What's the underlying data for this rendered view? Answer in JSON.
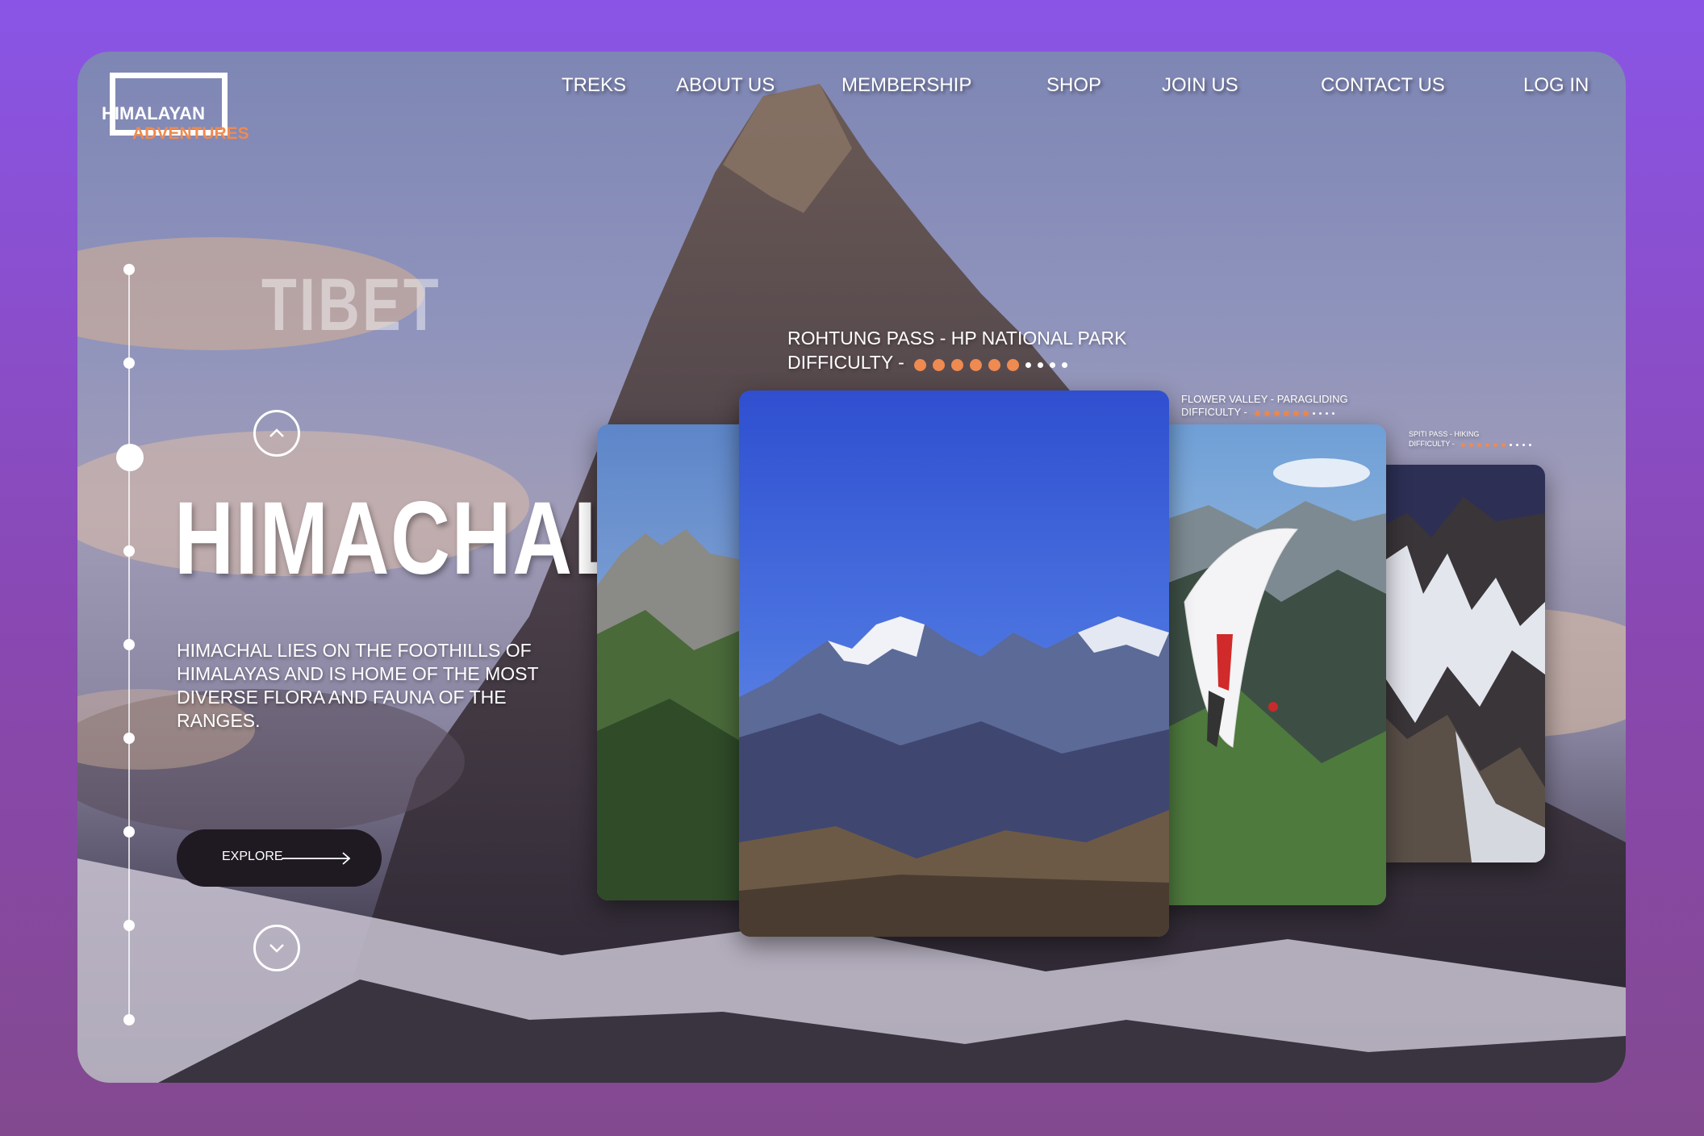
{
  "logo": {
    "line1": "HIMALAYAN",
    "line2": "ADVENTURES"
  },
  "nav": {
    "treks": "TREKS",
    "about": "ABOUT US",
    "membership": "MEMBERSHIP",
    "shop": "SHOP",
    "join": "JOIN US",
    "contact": "CONTACT US",
    "login": "LOG IN"
  },
  "hero": {
    "prev_region": "TIBET",
    "title": "HIMACHAL",
    "description": "HIMACHAL LIES ON THE FOOTHILLS OF HIMALAYAS AND IS HOME OF THE MOST DIVERSE FLORA AND FAUNA OF THE RANGES.",
    "explore_label": "EXPLORE"
  },
  "cards": {
    "main": {
      "title": "ROHTUNG PASS - HP NATIONAL PARK",
      "difficulty_label": "DIFFICULTY -",
      "difficulty": 6,
      "max": 10
    },
    "second": {
      "title": "FLOWER VALLEY - PARAGLIDING",
      "difficulty_label": "DIFFICULTY -",
      "difficulty": 6,
      "max": 10
    },
    "third": {
      "title": "SPITI PASS - HIKING",
      "difficulty_label": "DIFFICULTY -",
      "difficulty": 6,
      "max": 10
    }
  },
  "colors": {
    "accent": "#ef8a50",
    "background": "#8a55e6",
    "button": "#1f1a22"
  }
}
